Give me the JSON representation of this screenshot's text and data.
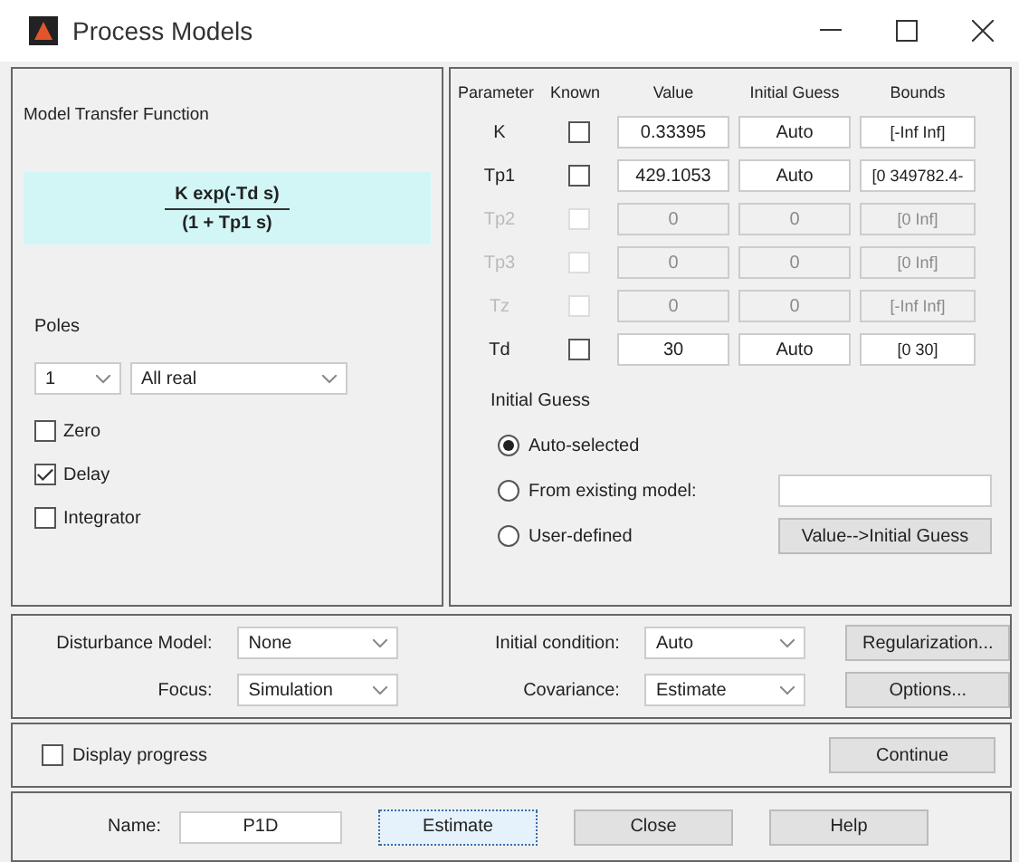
{
  "window": {
    "title": "Process Models"
  },
  "model": {
    "heading": "Model Transfer Function",
    "numerator": "K exp(-Td s)",
    "denominator": "(1 + Tp1 s)",
    "poles_label": "Poles",
    "poles_count": "1",
    "poles_type": "All real",
    "options": [
      {
        "label": "Zero",
        "checked": false
      },
      {
        "label": "Delay",
        "checked": true
      },
      {
        "label": "Integrator",
        "checked": false
      }
    ]
  },
  "parameters": {
    "columns": [
      "Parameter",
      "Known",
      "Value",
      "Initial Guess",
      "Bounds"
    ],
    "rows": [
      {
        "name": "K",
        "known": false,
        "value": "0.33395",
        "guess": "Auto",
        "bounds": "[-Inf Inf]",
        "disabled": false
      },
      {
        "name": "Tp1",
        "known": false,
        "value": "429.1053",
        "guess": "Auto",
        "bounds": "[0 349782.4-",
        "disabled": false
      },
      {
        "name": "Tp2",
        "known": false,
        "value": "0",
        "guess": "0",
        "bounds": "[0 Inf]",
        "disabled": true
      },
      {
        "name": "Tp3",
        "known": false,
        "value": "0",
        "guess": "0",
        "bounds": "[0 Inf]",
        "disabled": true
      },
      {
        "name": "Tz",
        "known": false,
        "value": "0",
        "guess": "0",
        "bounds": "[-Inf Inf]",
        "disabled": true
      },
      {
        "name": "Td",
        "known": false,
        "value": "30",
        "guess": "Auto",
        "bounds": "[0 30]",
        "disabled": false
      }
    ]
  },
  "initial_guess": {
    "heading": "Initial Guess",
    "choices": [
      {
        "label": "Auto-selected",
        "selected": true
      },
      {
        "label": "From existing model:",
        "selected": false
      },
      {
        "label": "User-defined",
        "selected": false
      }
    ],
    "transfer_button": "Value-->Initial Guess"
  },
  "settings": {
    "disturbance_label": "Disturbance Model:",
    "disturbance": "None",
    "focus_label": "Focus:",
    "focus": "Simulation",
    "initial_condition_label": "Initial condition:",
    "initial_condition": "Auto",
    "covariance_label": "Covariance:",
    "covariance": "Estimate",
    "regularization_button": "Regularization...",
    "options_button": "Options..."
  },
  "progress": {
    "label": "Display progress",
    "checked": false,
    "continue_button": "Continue"
  },
  "footer": {
    "name_label": "Name:",
    "name": "P1D",
    "buttons": [
      "Estimate",
      "Close",
      "Help"
    ]
  }
}
